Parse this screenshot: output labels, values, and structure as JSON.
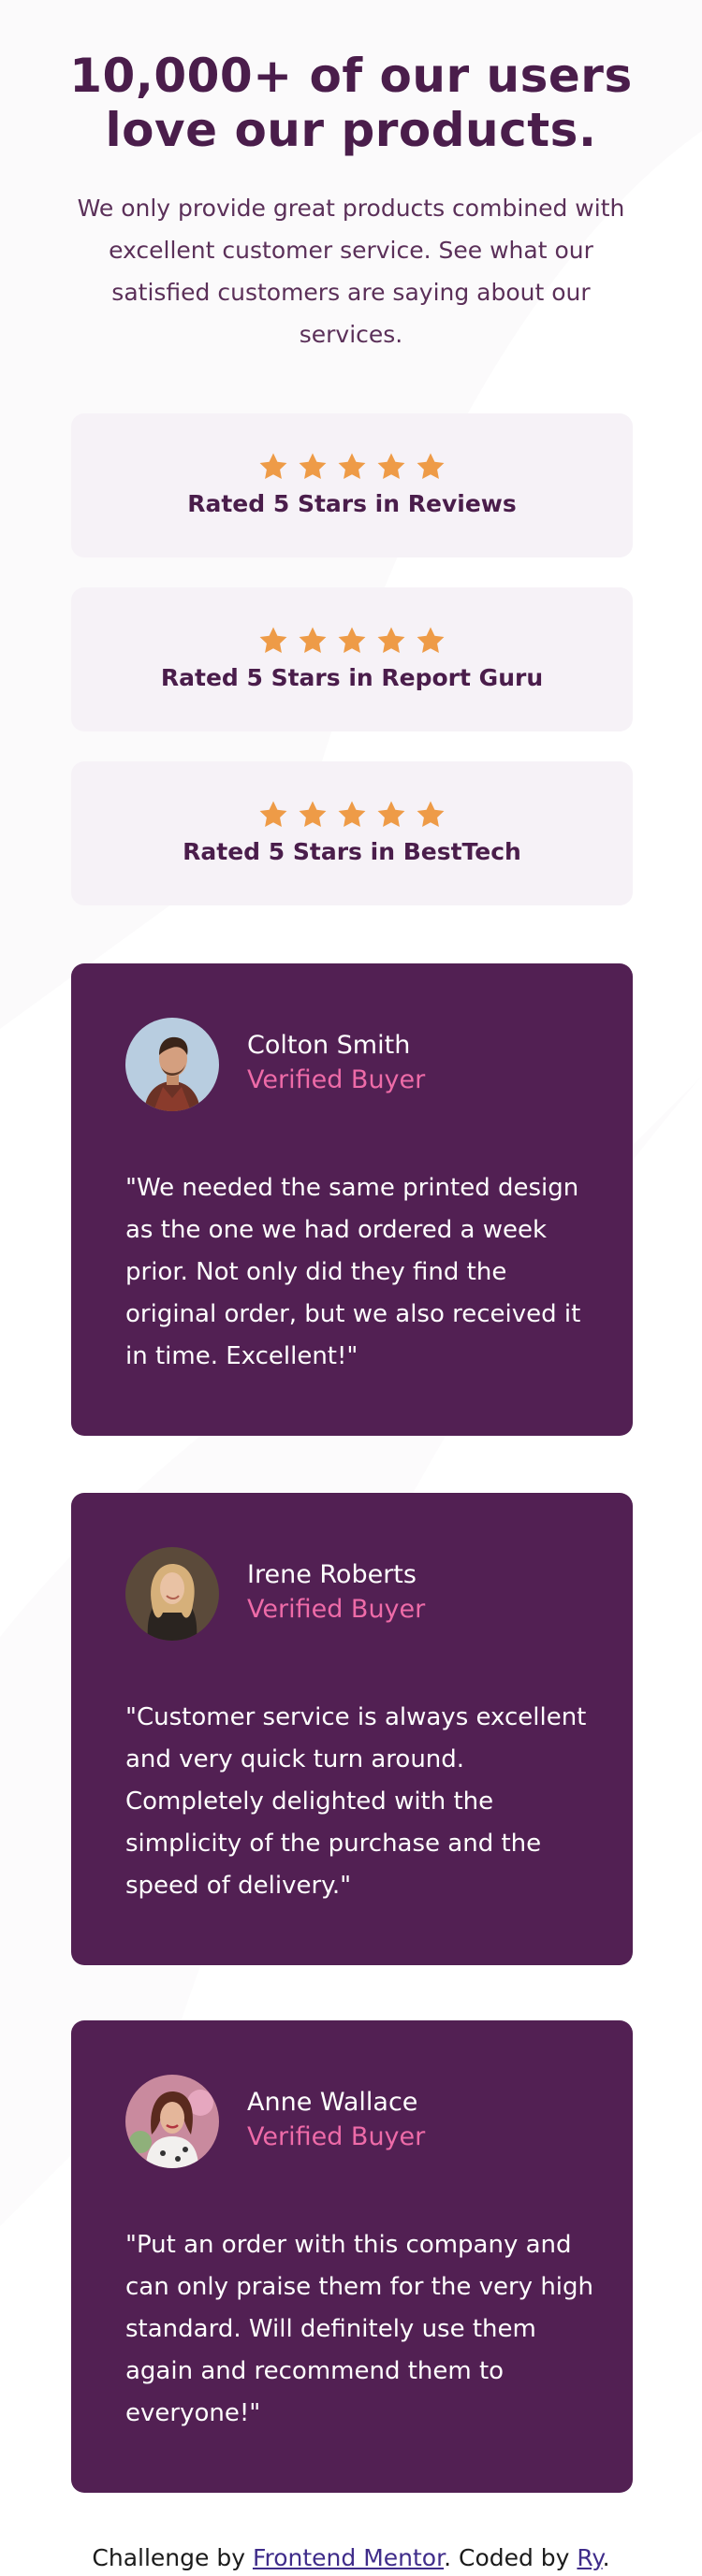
{
  "header": {
    "title_line1": "10,000+ of our users",
    "title_line2": "love our products.",
    "intro": "We only provide great products combined with excellent customer service. See what our satisfied customers are saying about our services."
  },
  "ratings": [
    {
      "label": "Rated 5 Stars in Reviews",
      "stars": 5
    },
    {
      "label": "Rated 5 Stars in Report Guru",
      "stars": 5
    },
    {
      "label": "Rated 5 Stars in BestTech",
      "stars": 5
    }
  ],
  "testimonials": [
    {
      "name": "Colton Smith",
      "status": "Verified Buyer",
      "quote": "\"We needed the same printed design as the one we had ordered a week prior. Not only did they find the original order, but we also received it in time. Excellent!\""
    },
    {
      "name": "Irene Roberts",
      "status": "Verified Buyer",
      "quote": "\"Customer service is always excellent and very quick turn around. Completely delighted with the simplicity of the purchase and the speed of delivery.\""
    },
    {
      "name": "Anne Wallace",
      "status": "Verified Buyer",
      "quote": "\"Put an order with this company and can only praise them for the very high standard. Will definitely use them again and recommend them to everyone!\""
    }
  ],
  "footer": {
    "prefix": "Challenge by ",
    "link1": "Frontend Mentor",
    "middle": ". Coded by ",
    "link2": "Ry",
    "suffix": "."
  },
  "colors": {
    "primary": "#4a1d4b",
    "card_bg": "#522053",
    "rating_bg": "#f6f2f7",
    "accent_pink": "#ee6ba8",
    "star": "#ee9b47"
  }
}
